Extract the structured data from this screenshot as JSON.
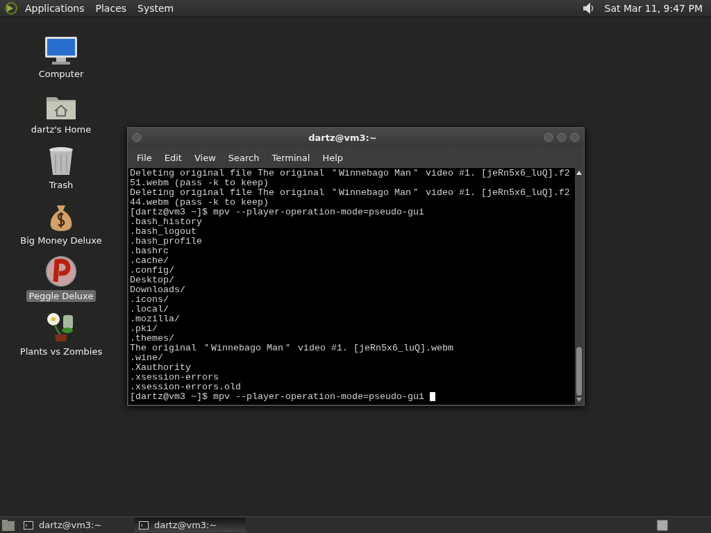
{
  "top_panel": {
    "menus": [
      "Applications",
      "Places",
      "System"
    ],
    "clock": "Sat Mar 11,  9:47 PM"
  },
  "desktop_icons": [
    {
      "label": "Computer",
      "kind": "computer",
      "selected": false
    },
    {
      "label": "dartz's Home",
      "kind": "home",
      "selected": false
    },
    {
      "label": "Trash",
      "kind": "trash",
      "selected": false
    },
    {
      "label": "Big Money Deluxe",
      "kind": "moneybag",
      "selected": false
    },
    {
      "label": "Peggle Deluxe",
      "kind": "peggle",
      "selected": true
    },
    {
      "label": "Plants vs Zombies",
      "kind": "plant",
      "selected": false
    }
  ],
  "terminal": {
    "title": "dartz@vm3:~",
    "menu": [
      "File",
      "Edit",
      "View",
      "Search",
      "Terminal",
      "Help"
    ],
    "lines": [
      "Deleting original file The original ＂Winnebago Man＂ video #1. [jeRn5x6_luQ].f2",
      "51.webm (pass -k to keep)",
      "Deleting original file The original ＂Winnebago Man＂ video #1. [jeRn5x6_luQ].f2",
      "44.webm (pass -k to keep)",
      "[dartz@vm3 ~]$ mpv --player-operation-mode=pseudo-gui",
      ".bash_history",
      ".bash_logout",
      ".bash_profile",
      ".bashrc",
      ".cache/",
      ".config/",
      "Desktop/",
      "Downloads/",
      ".icons/",
      ".local/",
      ".mozilla/",
      ".pki/",
      ".themes/",
      "The original ＂Winnebago Man＂ video #1. [jeRn5x6_luQ].webm",
      ".wine/",
      ".Xauthority",
      ".xsession-errors",
      ".xsession-errors.old",
      "[dartz@vm3 ~]$ mpv --player-operation-mode=pseudo-gui "
    ]
  },
  "taskbar": {
    "buttons": [
      {
        "label": "dartz@vm3:~",
        "selected": false
      },
      {
        "label": "dartz@vm3:~",
        "selected": true
      }
    ]
  }
}
